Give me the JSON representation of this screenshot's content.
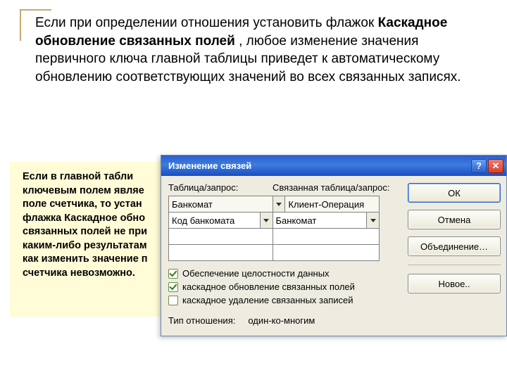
{
  "slide": {
    "main_prefix": "Если при определении отношения установить флажок ",
    "main_bold": "Каскадное обновление связанных полей ",
    "main_suffix": ", любое изменение значения первичного ключа главной таблицы приведет к автоматическому обновлению соответствующих значений во всех связанных записях."
  },
  "sidebox": {
    "l1a": "Если в главной табли",
    "l1b": "ключевым полем являе",
    "l1c": "поле счетчика, то устан",
    "l2_pre": "флажка ",
    "l2_bold": "Каскадное обно",
    "l3_bold": "связанных полей",
    "l3_rest": " не при",
    "l4": "каким-либо результатам",
    "l5": "как изменить значение п",
    "l6": "счетчика невозможно."
  },
  "dialog": {
    "title": "Изменение связей",
    "help_glyph": "?",
    "close_glyph": "✕",
    "lbl_table": "Таблица/запрос:",
    "lbl_related": "Связанная таблица/запрос:",
    "val_left_hdr": "Банкомат",
    "val_right_hdr": "Клиент-Операция",
    "val_left_row": "Код банкомата",
    "val_right_row": "Банкомат",
    "chk1_label": "Обеспечение целостности данных",
    "chk2_label": "каскадное обновление связанных полей",
    "chk3_label": "каскадное удаление связанных записей",
    "rel_label": "Тип отношения:",
    "rel_value": "один-ко-многим",
    "btn_ok": "ОК",
    "btn_cancel": "Отмена",
    "btn_join": "Объединение…",
    "btn_new": "Новое.."
  }
}
